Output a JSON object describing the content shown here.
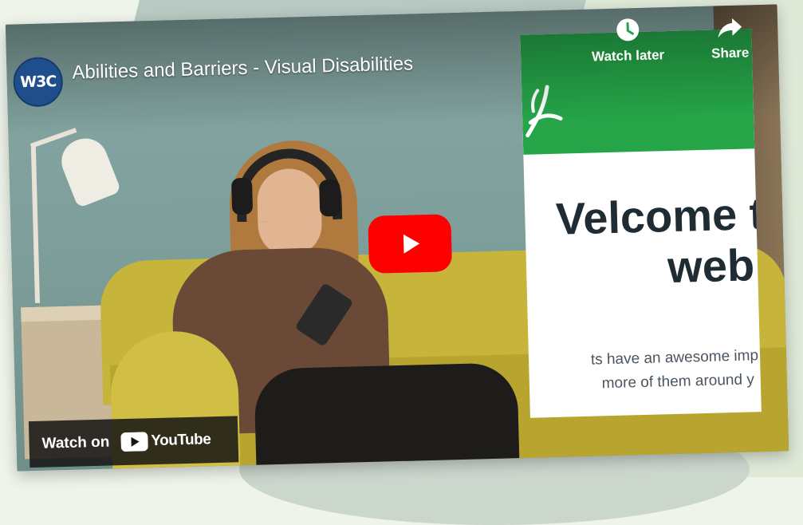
{
  "video": {
    "title": "Abilities and Barriers - Visual Disabilities",
    "channel_avatar_text": "W3C"
  },
  "controls": {
    "watch_later_label": "Watch later",
    "share_label": "Share",
    "watch_later_icon": "clock-icon",
    "share_icon": "share-arrow-icon",
    "play_icon": "play-icon"
  },
  "slide": {
    "heading_line1": "Velcome t",
    "heading_line2": "web",
    "body_line1": "ts have an awesome imp",
    "body_line2": "more of them around y",
    "header_color": "#25a548"
  },
  "footer": {
    "watch_on_label": "Watch on",
    "youtube_wordmark": "YouTube",
    "youtube_icon": "youtube-logo-icon"
  },
  "colors": {
    "play_button": "#ff0000",
    "avatar": "#1f4e8c",
    "background": "#eef4ea"
  }
}
